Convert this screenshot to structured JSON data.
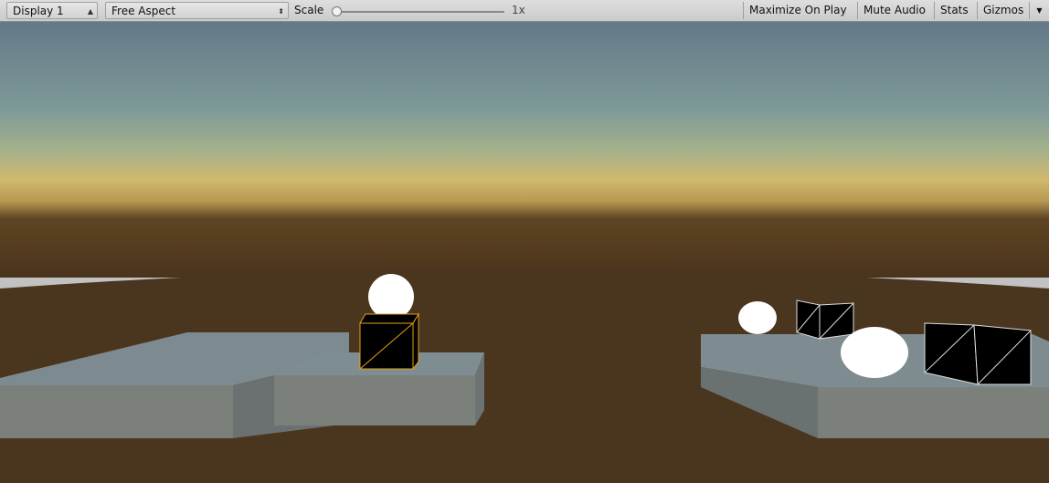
{
  "toolbar": {
    "display": "Display 1",
    "aspect": "Free Aspect",
    "scale_label": "Scale",
    "scale_value": "1x",
    "maximize": "Maximize On Play",
    "mute": "Mute Audio",
    "stats": "Stats",
    "gizmos": "Gizmos"
  },
  "icons": {
    "dropdown": "up-down-arrows-icon",
    "gizmos_menu": "triangle-down-icon"
  },
  "scene": {
    "sky_top": "#667d89",
    "horizon": "#c9b36b",
    "ground": "#4a361f",
    "platform": "#7d8a8e",
    "selection": "#e8a019"
  }
}
